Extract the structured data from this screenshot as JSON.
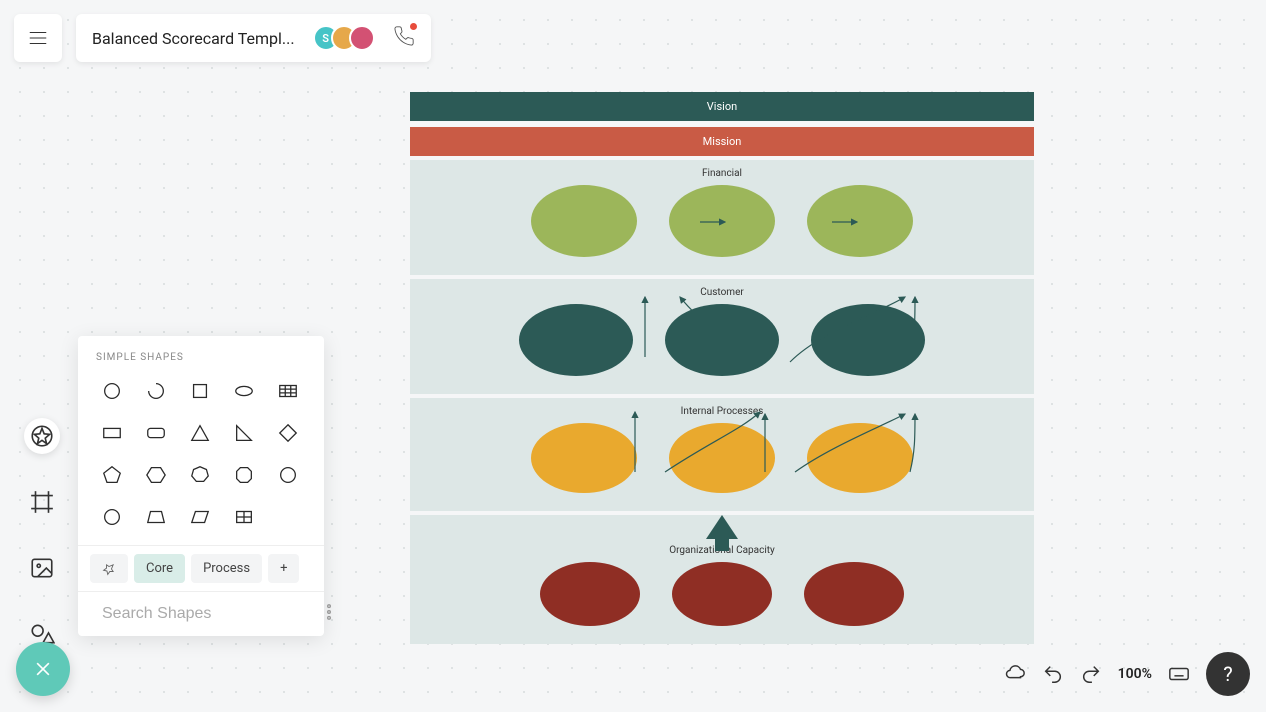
{
  "header": {
    "title": "Balanced Scorecard Templ...",
    "avatars": [
      "S",
      "",
      ""
    ]
  },
  "shapes_panel": {
    "title": "SIMPLE SHAPES",
    "tabs": {
      "pin": "",
      "core": "Core",
      "process": "Process",
      "add": "+"
    },
    "search_placeholder": "Search Shapes"
  },
  "diagram": {
    "vision": "Vision",
    "mission": "Mission",
    "sections": {
      "financial": "Financial",
      "customer": "Customer",
      "internal": "Internal Processes",
      "capacity": "Organizational Capacity"
    }
  },
  "footer": {
    "zoom": "100%"
  },
  "help": "?"
}
